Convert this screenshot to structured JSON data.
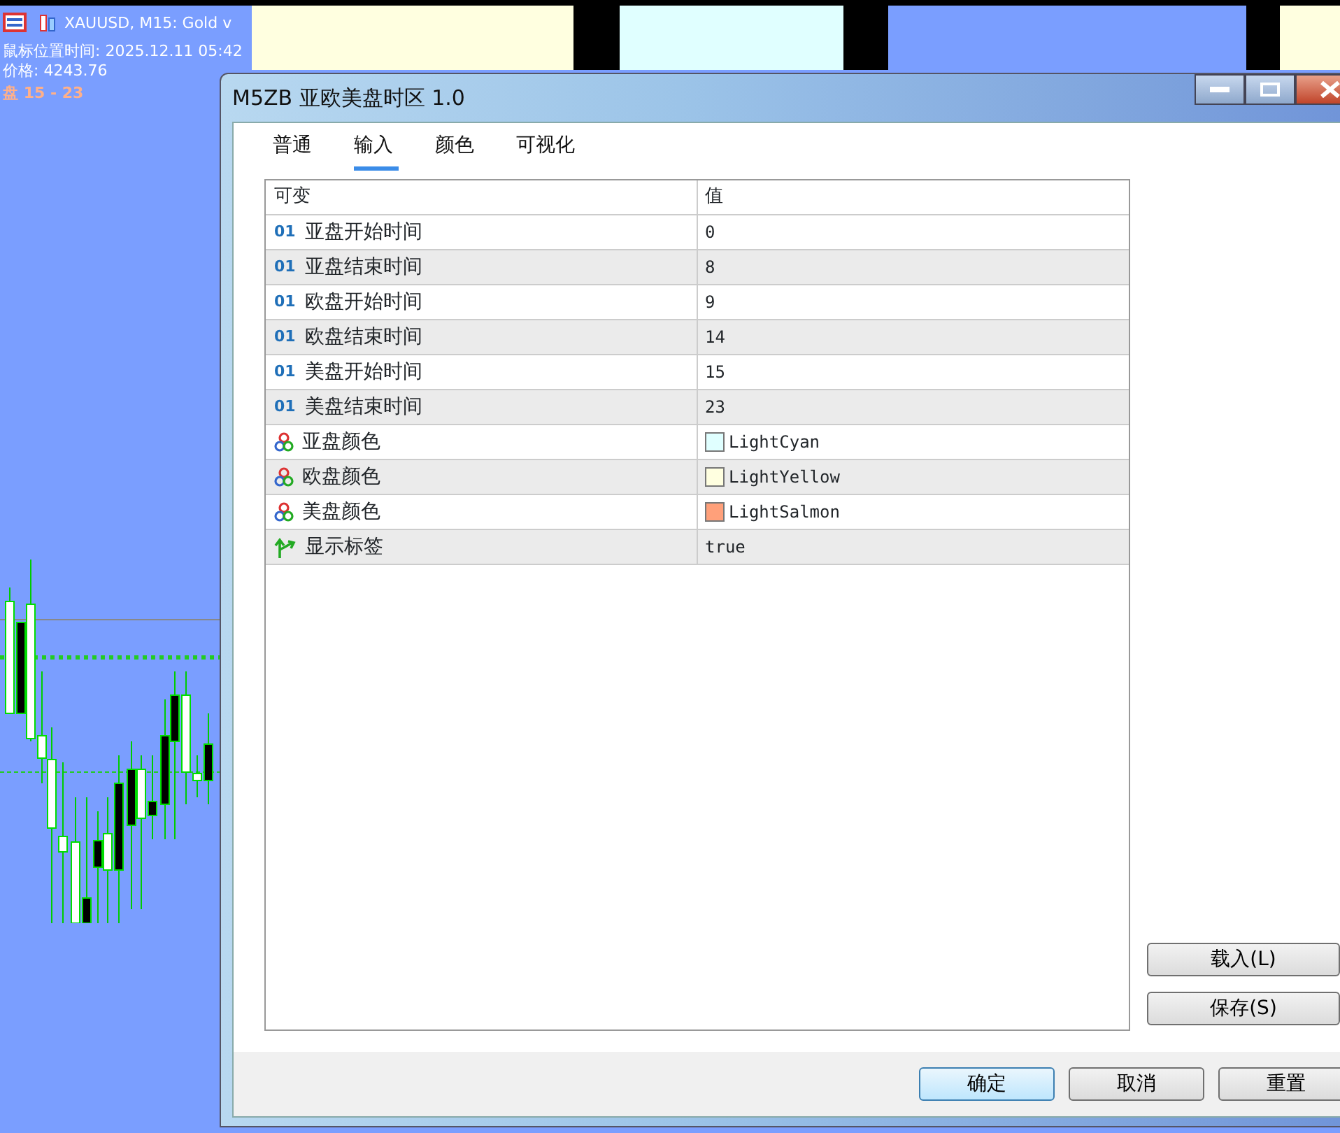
{
  "chart": {
    "symbol_line": "XAUUSD, M15:  Gold v",
    "mouse_time": "鼠标位置时间: 2025.12.11 05:42",
    "price": "价格: 4243.76",
    "session_label": "盘 15 - 23"
  },
  "dialog": {
    "title": "M5ZB 亚欧美盘时区 1.0",
    "tabs": [
      {
        "label": "普通",
        "selected": false
      },
      {
        "label": "输入",
        "selected": true
      },
      {
        "label": "颜色",
        "selected": false
      },
      {
        "label": "可视化",
        "selected": false
      }
    ],
    "table": {
      "columns": [
        "可变",
        "值"
      ],
      "rows": [
        {
          "kind": "int",
          "badge": "01",
          "name": "亚盘开始时间",
          "value": "0"
        },
        {
          "kind": "int",
          "badge": "01",
          "name": "亚盘结束时间",
          "value": "8"
        },
        {
          "kind": "int",
          "badge": "01",
          "name": "欧盘开始时间",
          "value": "9"
        },
        {
          "kind": "int",
          "badge": "01",
          "name": "欧盘结束时间",
          "value": "14"
        },
        {
          "kind": "int",
          "badge": "01",
          "name": "美盘开始时间",
          "value": "15"
        },
        {
          "kind": "int",
          "badge": "01",
          "name": "美盘结束时间",
          "value": "23"
        },
        {
          "kind": "color",
          "name": "亚盘颜色",
          "value": "LightCyan",
          "color": "#e0ffff"
        },
        {
          "kind": "color",
          "name": "欧盘颜色",
          "value": "LightYellow",
          "color": "#ffffe0"
        },
        {
          "kind": "color",
          "name": "美盘颜色",
          "value": "LightSalmon",
          "color": "#ffa07a"
        },
        {
          "kind": "bool",
          "name": "显示标签",
          "value": "true"
        }
      ]
    },
    "side_buttons": [
      "载入(L)",
      "保存(S)"
    ],
    "footer_buttons": [
      {
        "label": "确定",
        "default": true
      },
      {
        "label": "取消",
        "default": false
      },
      {
        "label": "重置",
        "default": false
      }
    ]
  }
}
